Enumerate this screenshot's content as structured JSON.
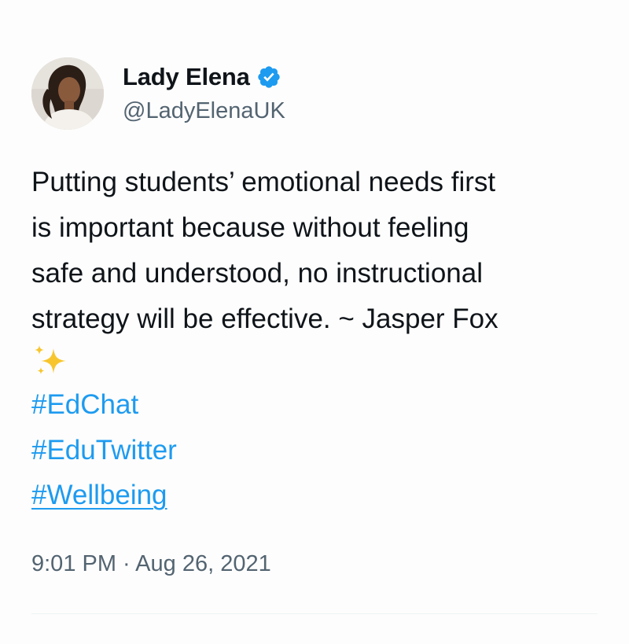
{
  "author": {
    "display_name": "Lady Elena",
    "handle": "@LadyElenaUK",
    "verified_icon": "verified-badge-icon",
    "accent_color": "#1d9bf0"
  },
  "tweet": {
    "text_lines": [
      "Putting students’ emotional needs first",
      "is important because without feeling",
      "safe and understood, no instructional",
      "strategy will be effective. ~ Jasper Fox"
    ],
    "emoji": "sparkles-icon",
    "hashtags": [
      "#EdChat",
      "#EduTwitter",
      "#Wellbeing"
    ],
    "timestamp": "9:01 PM · Aug 26, 2021"
  }
}
